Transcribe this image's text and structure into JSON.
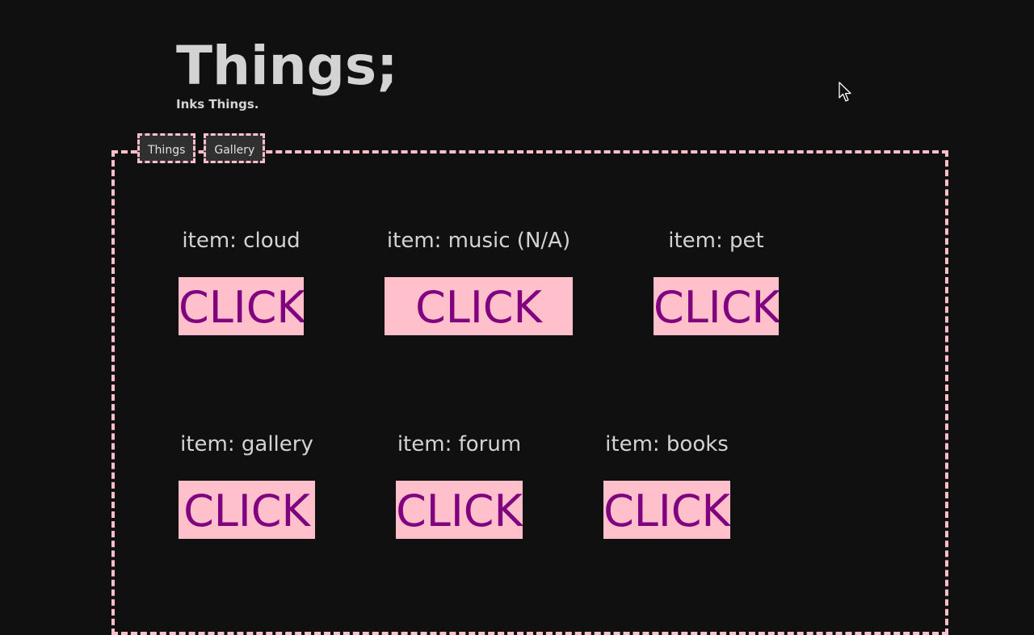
{
  "header": {
    "title": "Things;",
    "subtitle": "Inks Things."
  },
  "tabs": [
    {
      "label": "Things"
    },
    {
      "label": "Gallery"
    }
  ],
  "items": [
    {
      "label": "item: cloud",
      "button_label": "CLICK"
    },
    {
      "label": "item: music (N/A)",
      "button_label": "CLICK"
    },
    {
      "label": "item: pet",
      "button_label": "CLICK"
    },
    {
      "label": "item: gallery",
      "button_label": "CLICK"
    },
    {
      "label": "item: forum",
      "button_label": "CLICK"
    },
    {
      "label": "item: books",
      "button_label": "CLICK"
    }
  ],
  "colors": {
    "background": "#101010",
    "accent_border": "#ffc0cb",
    "button_bg": "#ffc0cb",
    "button_text": "#800080",
    "text": "#d3d3d3"
  }
}
